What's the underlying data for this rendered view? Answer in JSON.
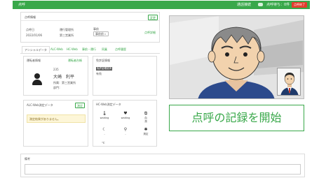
{
  "topbar": {
    "title": "点呼",
    "status_label": "通話接続",
    "count_label": "点呼待ち：0件",
    "end_button": "点呼終了"
  },
  "info_panel": {
    "header": "点呼情報",
    "change_button": "変更",
    "date_label": "点呼日",
    "date_value": "2022/01/06",
    "office_label": "運行管理所",
    "office_value": "第三営業所",
    "timing_label": "事前",
    "timing_select": "事前前",
    "link_text": "点呼詳細"
  },
  "tabs": [
    "アンシャルデータ",
    "ALC-Web",
    "HC-Web",
    "事前・運行",
    "同乗",
    "点呼履歴"
  ],
  "driver_panel": {
    "header": "運転者情報",
    "link": "運転者台帳",
    "code": "235",
    "name": "大崎　利平",
    "office": "所属：第三営業所",
    "dept": "部門："
  },
  "license_panel": {
    "header": "免許証情報",
    "badge": "免許証確認済",
    "status": "有効"
  },
  "alc_panel": {
    "header": "ALC-Web測定データ",
    "button": "測定",
    "warning": "測定結果がありません。"
  },
  "hc_panel": {
    "header": "HC-Web測定データ",
    "items": [
      {
        "icon": "thermometer-icon",
        "glyph": "🌡",
        "label": "waiting",
        "value": ""
      },
      {
        "icon": "heart-icon",
        "glyph": "♥",
        "label": "waiting",
        "value": ""
      },
      {
        "icon": "bp-icon",
        "glyph": "⧉",
        "label": "血",
        "value": "測"
      },
      {
        "icon": "bed-icon",
        "glyph": "☾",
        "label": "-",
        "value": ""
      },
      {
        "icon": "walk-icon",
        "glyph": "⚲",
        "label": "-",
        "value": ""
      },
      {
        "icon": "lab-icon",
        "glyph": "✱",
        "label": "測定",
        "value": ""
      }
    ],
    "footnote": "℃"
  },
  "notes_panel": {
    "header": "備考",
    "placeholder": ""
  },
  "start_rollcall": "点呼の記録を開始",
  "colors": {
    "accent": "#39a84a",
    "danger": "#e33b2c"
  }
}
